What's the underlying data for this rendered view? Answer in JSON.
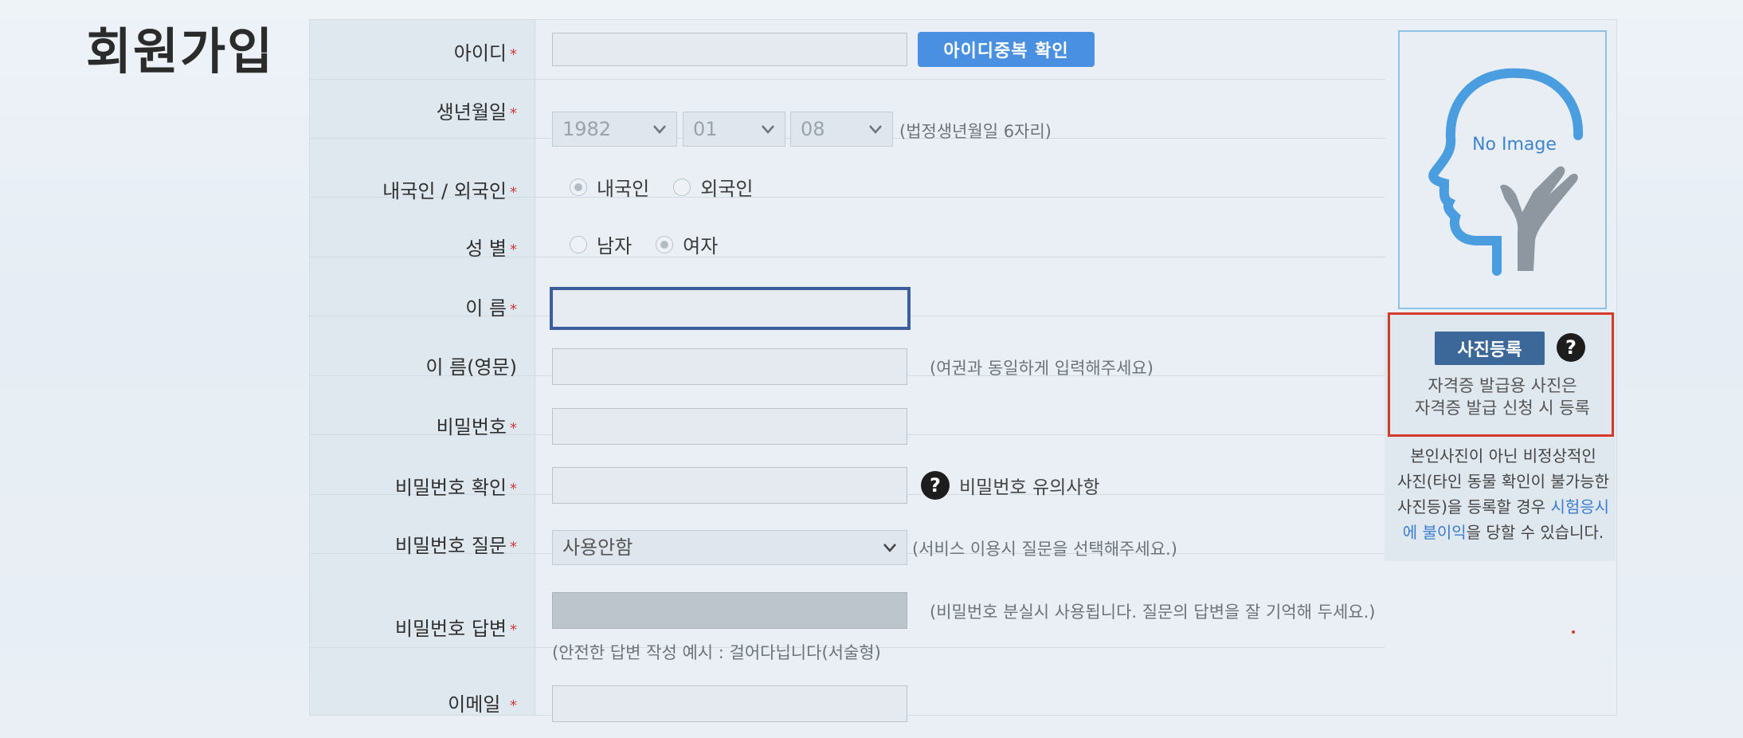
{
  "page_title": "회원가입",
  "fields": {
    "id": {
      "label": "아이디",
      "button": "아이디중복 확인"
    },
    "birth": {
      "label": "생년월일",
      "year": "1982",
      "month": "01",
      "day": "08",
      "hint": "(법정생년월일 6자리)"
    },
    "nationality": {
      "label": "내국인 / 외국인",
      "options": [
        "내국인",
        "외국인"
      ],
      "selected": "내국인"
    },
    "gender": {
      "label": "성 별",
      "options": [
        "남자",
        "여자"
      ],
      "selected": "여자"
    },
    "name": {
      "label": "이 름"
    },
    "name_en": {
      "label": "이 름(영문)",
      "hint": "(여권과 동일하게 입력해주세요)"
    },
    "password": {
      "label": "비밀번호"
    },
    "password_confirm": {
      "label": "비밀번호 확인",
      "help": "비밀번호 유의사항"
    },
    "password_question": {
      "label": "비밀번호 질문",
      "selected": "사용안함",
      "hint": "(서비스 이용시 질문을 선택해주세요.)"
    },
    "password_answer": {
      "label": "비밀번호 답변",
      "hint": "(비밀번호 분실시 사용됩니다. 질문의 답변을 잘 기억해 두세요.)",
      "example": "(안전한 답변 작성 예시 : 걸어다닙니다(서술형)"
    },
    "email": {
      "label": "이메일"
    }
  },
  "required_mark": "*",
  "photo": {
    "placeholder": "No Image",
    "button": "사진등록",
    "note_line1": "자격증 발급용 사진은",
    "note_line2": "자격증 발급 신청 시 등록",
    "warning_line1": "본인사진이 아닌 비정상적인",
    "warning_line2": "사진(타인 동물 확인이 불가능한",
    "warning_line3a": "사진등)을 등록할 경우 ",
    "warning_line3b": "시험응시",
    "warning_line4a": "에 불이익",
    "warning_line4b": "을 당할 수 있습니다."
  },
  "colors": {
    "accent_button": "#4a90e2",
    "photo_button": "#3c6799",
    "required_star": "#d03a3a",
    "highlight": "#d23a2c",
    "link_blue": "#3b7ed0"
  }
}
